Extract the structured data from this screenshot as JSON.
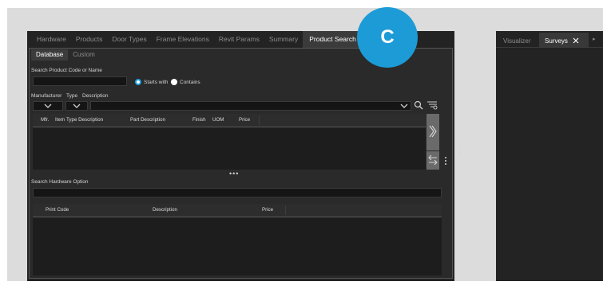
{
  "main_tabs": [
    {
      "label": "Hardware",
      "active": false
    },
    {
      "label": "Products",
      "active": false
    },
    {
      "label": "Door Types",
      "active": false
    },
    {
      "label": "Frame Elevations",
      "active": false
    },
    {
      "label": "Revit Params",
      "active": false
    },
    {
      "label": "Summary",
      "active": false
    },
    {
      "label": "Product Search",
      "active": true
    }
  ],
  "sub_tabs": [
    {
      "label": "Database",
      "active": true
    },
    {
      "label": "Custom",
      "active": false
    }
  ],
  "search": {
    "label": "Search Product Code or Name",
    "value": "",
    "radio_starts_with": "Starts with",
    "radio_contains": "Contains",
    "selected": "Starts with"
  },
  "filters": {
    "manufacturer_label": "Manufacturer",
    "type_label": "Type",
    "description_label": "Description"
  },
  "product_table": {
    "columns": [
      "Mfr.",
      "Item",
      "Type Description",
      "Part Description",
      "Finish",
      "UOM",
      "Price"
    ]
  },
  "hardware": {
    "label": "Search Hardware Option",
    "value": "",
    "columns": [
      "Print Code",
      "Description",
      "Price"
    ]
  },
  "badge": {
    "letter": "C",
    "color": "#1c9bd7"
  },
  "right_panel_tabs": [
    {
      "label": "Visualizer",
      "active": false
    },
    {
      "label": "Surveys",
      "active": true,
      "closable": true
    }
  ],
  "colors": {
    "accent": "#1ea1df",
    "panel": "#232323",
    "background": "#dcdcdc"
  },
  "icons": [
    "chevron-down-icon",
    "search-icon",
    "filter-clear-icon",
    "double-chevron-right-icon",
    "swap-arrows-icon",
    "vertical-dots-icon",
    "horizontal-dots-icon",
    "close-icon"
  ]
}
